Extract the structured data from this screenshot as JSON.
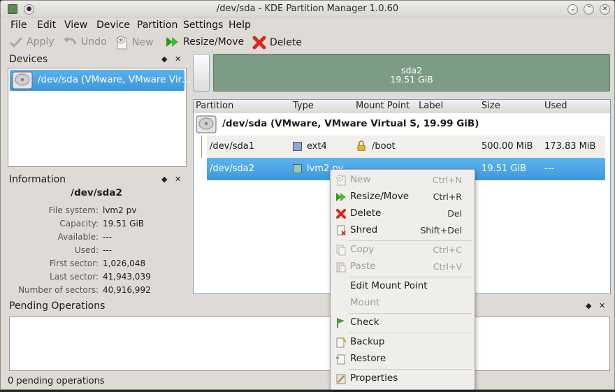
{
  "window": {
    "title": "/dev/sda - KDE Partition Manager 1.0.60"
  },
  "menu": [
    "File",
    "Edit",
    "View",
    "Device",
    "Partition",
    "Settings",
    "Help"
  ],
  "toolbar": {
    "apply": "Apply",
    "undo": "Undo",
    "new": "New",
    "resize": "Resize/Move",
    "delete": "Delete"
  },
  "devices": {
    "title": "Devices",
    "item": "/dev/sda (VMware, VMware Vir…"
  },
  "info": {
    "title": "Information",
    "heading": "/dev/sda2",
    "rows": [
      {
        "k": "File system:",
        "v": "lvm2 pv"
      },
      {
        "k": "Capacity:",
        "v": "19.51 GiB"
      },
      {
        "k": "Available:",
        "v": "---"
      },
      {
        "k": "Used:",
        "v": "---"
      },
      {
        "k": "First sector:",
        "v": "1,026,048"
      },
      {
        "k": "Last sector:",
        "v": "41,943,039"
      },
      {
        "k": "Number of sectors:",
        "v": "40,916,992"
      }
    ]
  },
  "bar": {
    "name": "sda2",
    "size": "19.51 GiB"
  },
  "table": {
    "headers": [
      "Partition",
      "Type",
      "Mount Point",
      "Label",
      "Size",
      "Used"
    ],
    "device": "/dev/sda (VMware, VMware Virtual S, 19.99 GiB)",
    "rows": [
      {
        "part": "/dev/sda1",
        "type": "ext4",
        "mount": "/boot",
        "size": "500.00 MiB",
        "used": "173.83 MiB",
        "color": "#8ea7d4"
      },
      {
        "part": "/dev/sda2",
        "type": "lvm2 pv",
        "mount": "",
        "size": "19.51 GiB",
        "used": "---",
        "color": "#9ac6c0"
      }
    ]
  },
  "pending": {
    "title": "Pending Operations"
  },
  "status": "0 pending operations",
  "context_menu": {
    "new": {
      "label": "New",
      "shortcut": "Ctrl+N"
    },
    "resize": {
      "label": "Resize/Move",
      "shortcut": "Ctrl+R"
    },
    "delete": {
      "label": "Delete",
      "shortcut": "Del"
    },
    "shred": {
      "label": "Shred",
      "shortcut": "Shift+Del"
    },
    "copy": {
      "label": "Copy",
      "shortcut": "Ctrl+C"
    },
    "paste": {
      "label": "Paste",
      "shortcut": "Ctrl+V"
    },
    "edit_mount": {
      "label": "Edit Mount Point"
    },
    "mount": {
      "label": "Mount"
    },
    "check": {
      "label": "Check"
    },
    "backup": {
      "label": "Backup"
    },
    "restore": {
      "label": "Restore"
    },
    "properties": {
      "label": "Properties"
    }
  },
  "colors": {
    "selection": "#3b97dc",
    "partition_bar": "#7d9c85"
  }
}
